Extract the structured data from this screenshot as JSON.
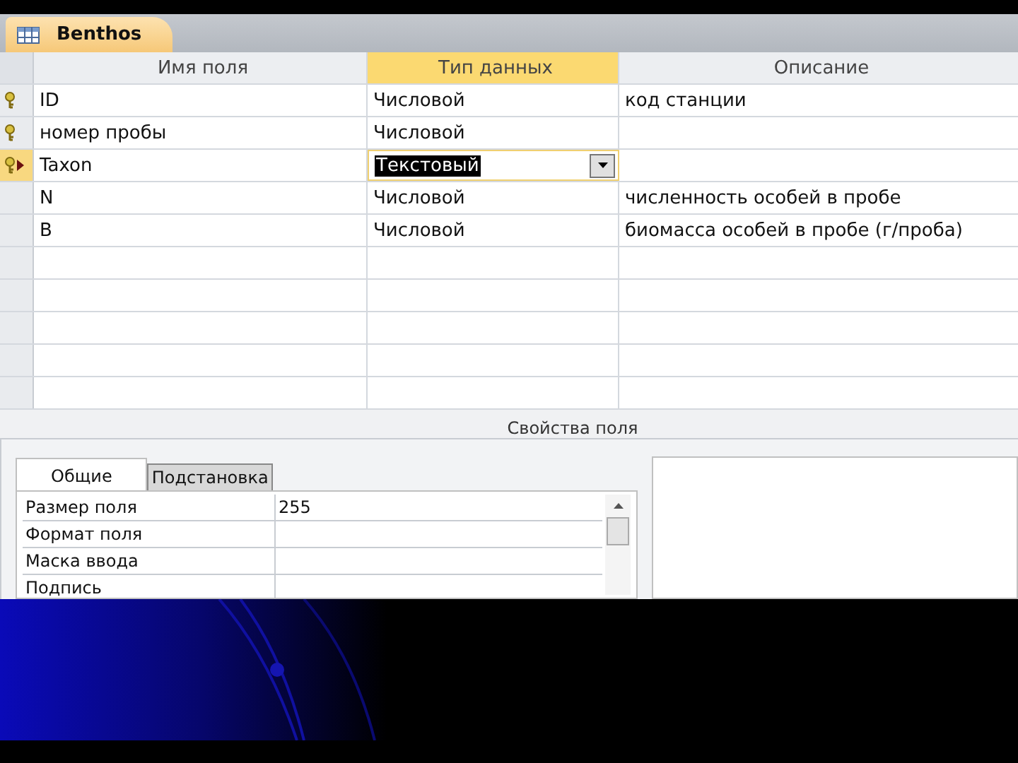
{
  "document_tab": {
    "title": "Benthos",
    "selected": true
  },
  "columns": [
    {
      "label": "Имя поля",
      "selected": false
    },
    {
      "label": "Тип данных",
      "selected": true
    },
    {
      "label": "Описание",
      "selected": false
    }
  ],
  "fields": [
    {
      "name": "ID",
      "type": "Числовой",
      "description": "код станции",
      "primary_key": true,
      "selected": false
    },
    {
      "name": "номер пробы",
      "type": "Числовой",
      "primary_key": true,
      "selected": false
    },
    {
      "name": "Taxon",
      "type": "Текстовый",
      "primary_key": true,
      "selected": true
    },
    {
      "name": "N",
      "type": "Числовой",
      "description": "численность особей в пробе",
      "primary_key": false,
      "selected": false
    },
    {
      "name": "B",
      "type": "Числовой",
      "description": "биомасса особей в пробе (г/проба)",
      "primary_key": false,
      "selected": false
    }
  ],
  "properties_title": "Свойства поля",
  "property_tabs": [
    {
      "label": "Общие",
      "selected": true
    },
    {
      "label": "Подстановка",
      "selected": false
    }
  ],
  "properties": [
    {
      "name": "Размер поля",
      "value": "255"
    },
    {
      "name": "Формат поля"
    },
    {
      "name": "Маска ввода"
    },
    {
      "name": "Подпись"
    }
  ]
}
